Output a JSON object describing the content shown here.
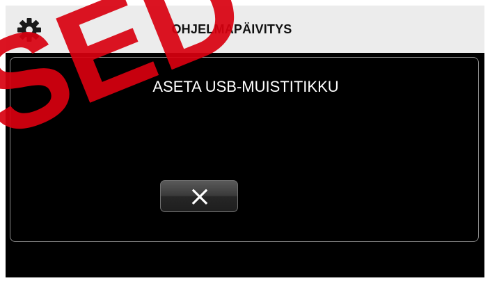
{
  "header": {
    "title": "OHJELMAPÄIVITYS",
    "icon": "gear-icon"
  },
  "dialog": {
    "message": "ASETA USB-MUISTITIKKU",
    "close_icon": "close-icon"
  },
  "watermark": {
    "text": "SED",
    "color": "#d8000f"
  },
  "colors": {
    "header_bg": "#ececec",
    "screen_bg": "#000000",
    "text": "#ffffff"
  }
}
